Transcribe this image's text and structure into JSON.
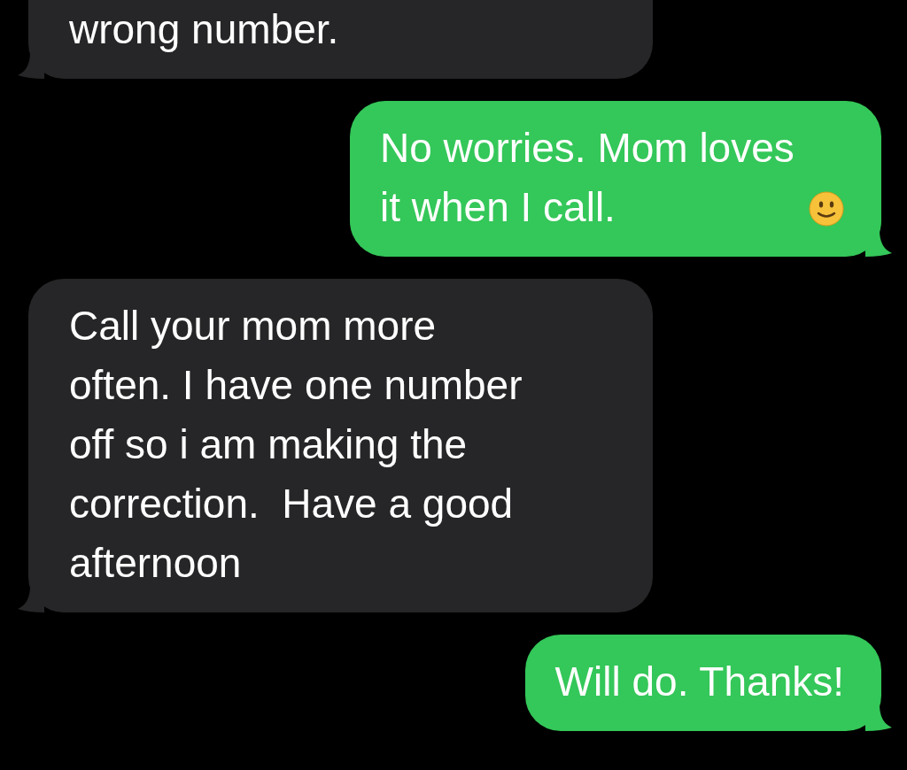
{
  "messages": [
    {
      "kind": "incoming",
      "text": "wrong number.",
      "cut_top": true,
      "emoji": false
    },
    {
      "kind": "outgoing",
      "text": "No worries. Mom loves it when I call.",
      "cut_top": false,
      "emoji": true
    },
    {
      "kind": "incoming",
      "text": "Call your mom more often. I have one number off so i am making the correction.  Have a good afternoon",
      "cut_top": false,
      "emoji": false
    },
    {
      "kind": "outgoing",
      "text": "Will do. Thanks!",
      "cut_top": false,
      "emoji": false
    }
  ]
}
